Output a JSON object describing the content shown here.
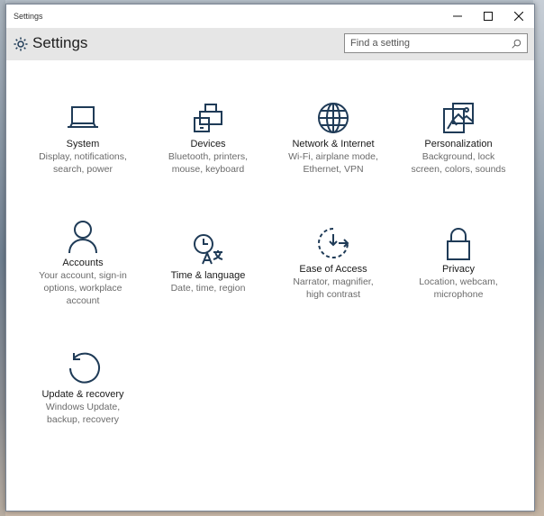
{
  "window": {
    "title": "Settings"
  },
  "header": {
    "title": "Settings",
    "search_placeholder": "Find a setting"
  },
  "colors": {
    "accent": "#1f3b57",
    "header_bg": "#e6e6e6",
    "text_secondary": "#6b6b6b"
  },
  "tiles": [
    {
      "icon": "laptop-icon",
      "name": "System",
      "desc": [
        "Display, notifications,",
        "search, power"
      ]
    },
    {
      "icon": "devices-icon",
      "name": "Devices",
      "desc": [
        "Bluetooth, printers,",
        "mouse, keyboard"
      ]
    },
    {
      "icon": "globe-icon",
      "name": "Network & Internet",
      "desc": [
        "Wi-Fi, airplane mode,",
        "Ethernet, VPN"
      ]
    },
    {
      "icon": "personalization-icon",
      "name": "Personalization",
      "desc": [
        "Background, lock",
        "screen, colors, sounds"
      ]
    },
    {
      "icon": "person-icon",
      "name": "Accounts",
      "desc": [
        "Your account, sign-in",
        "options, workplace",
        "account"
      ]
    },
    {
      "icon": "time-language-icon",
      "name": "Time & language",
      "desc": [
        "Date, time, region"
      ]
    },
    {
      "icon": "ease-of-access-icon",
      "name": "Ease of Access",
      "desc": [
        "Narrator, magnifier,",
        "high contrast"
      ]
    },
    {
      "icon": "lock-icon",
      "name": "Privacy",
      "desc": [
        "Location, webcam,",
        "microphone"
      ]
    },
    {
      "icon": "refresh-icon",
      "name": "Update & recovery",
      "desc": [
        "Windows Update,",
        "backup, recovery"
      ]
    }
  ]
}
